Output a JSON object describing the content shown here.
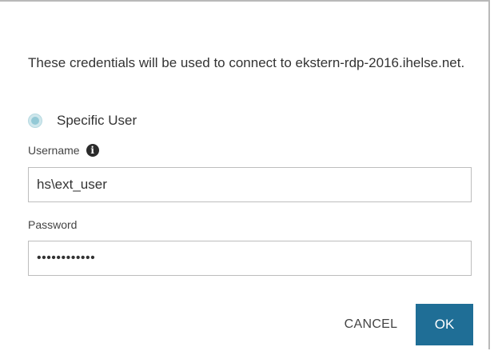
{
  "dialog": {
    "description": "These credentials will be used to connect to ekstern-rdp-2016.ihelse.net.",
    "radio": {
      "label": "Specific User",
      "selected": true
    },
    "username": {
      "label": "Username",
      "value": "hs\\ext_user",
      "info_icon": "info-icon"
    },
    "password": {
      "label": "Password",
      "masked_value": "••••••••••••"
    },
    "buttons": {
      "cancel_label": "CANCEL",
      "ok_label": "OK"
    },
    "colors": {
      "ok_button": "#1f6e96",
      "radio_fill": "#93c9d6",
      "border": "#bdbdbd"
    }
  }
}
